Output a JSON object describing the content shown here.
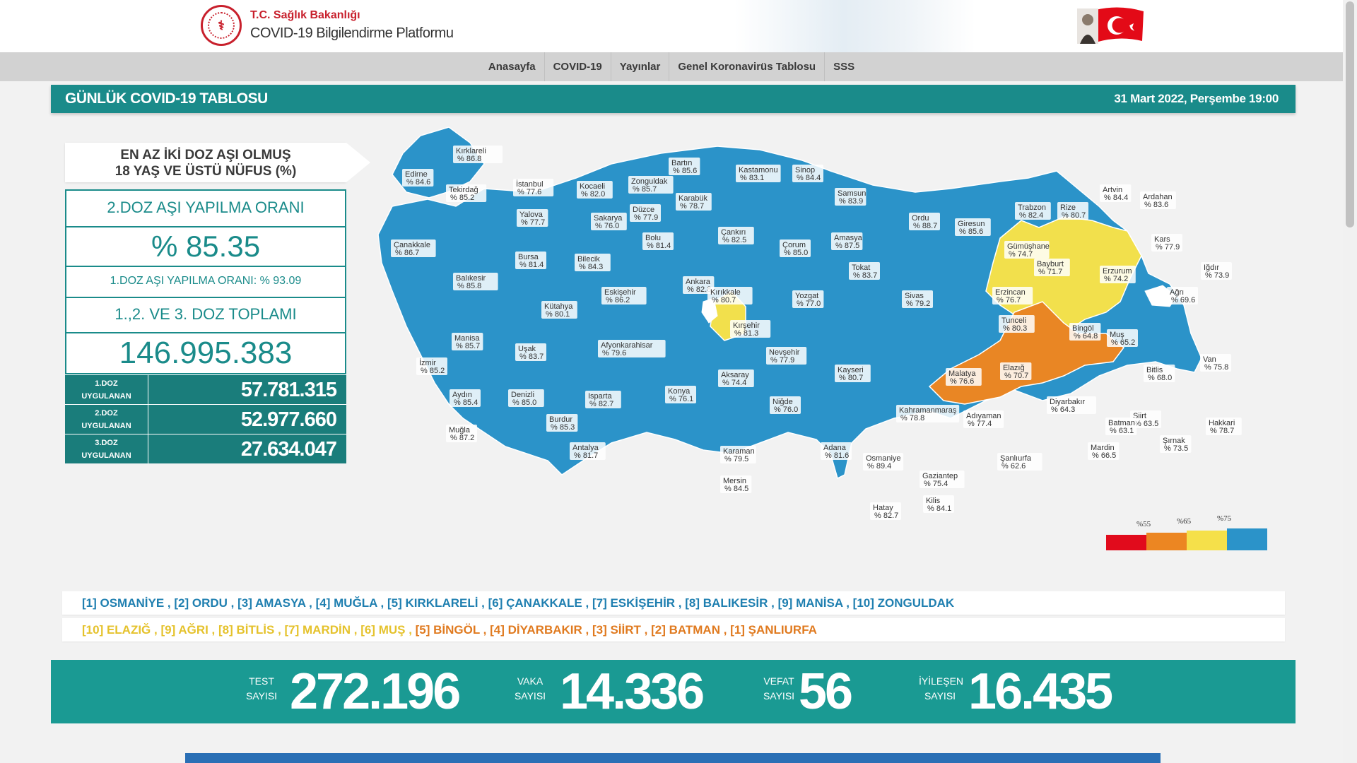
{
  "header": {
    "ministry": "T.C. Sağlık Bakanlığı",
    "platform": "COVID-19 Bilgilendirme Platformu"
  },
  "nav": [
    "Anasayfa",
    "COVID-19",
    "Yayınlar",
    "Genel Koronavirüs Tablosu",
    "SSS"
  ],
  "table_title": "GÜNLÜK COVID-19 TABLOSU",
  "date_text": "31 Mart 2022, Perşembe 19:00",
  "vaccine": {
    "title_line1": "EN AZ İKİ DOZ AŞI OLMUŞ",
    "title_line2": "18 YAŞ VE ÜSTÜ NÜFUS (%)",
    "second_dose_label": "2.DOZ AŞI YAPILMA ORANI",
    "second_dose_value": "% 85.35",
    "first_dose_rate": "1.DOZ AŞI YAPILMA ORANI: % 93.09",
    "total_label": "1.,2. VE 3. DOZ TOPLAMI",
    "total_value": "146.995.383",
    "doses": [
      {
        "label1": "1.DOZ",
        "label2": "UYGULANAN",
        "value": "57.781.315"
      },
      {
        "label1": "2.DOZ",
        "label2": "UYGULANAN",
        "value": "52.977.660"
      },
      {
        "label1": "3.DOZ",
        "label2": "UYGULANAN",
        "value": "27.634.047"
      }
    ]
  },
  "legend": {
    "ticks": [
      "%55",
      "%65",
      "%75"
    ],
    "colors": [
      "#e10b1c",
      "#ec8622",
      "#f5e04a",
      "#2b93c9"
    ]
  },
  "colors": {
    "teal": "#1a8b8a",
    "blue_province": "#2b93c9",
    "yellow_province": "#f2e04c",
    "orange_province": "#e98624",
    "yellow_text": "#e5c22c",
    "orange_text": "#e07a1f"
  },
  "top_ranking": [
    {
      "rank": "[1]",
      "name": "OSMANİYE"
    },
    {
      "rank": "[2]",
      "name": "ORDU"
    },
    {
      "rank": "[3]",
      "name": "AMASYA"
    },
    {
      "rank": "[4]",
      "name": "MUĞLA"
    },
    {
      "rank": "[5]",
      "name": "KIRKLARELİ"
    },
    {
      "rank": "[6]",
      "name": "ÇANAKKALE"
    },
    {
      "rank": "[7]",
      "name": "ESKİŞEHİR"
    },
    {
      "rank": "[8]",
      "name": "BALIKESİR"
    },
    {
      "rank": "[9]",
      "name": "MANİSA"
    },
    {
      "rank": "[10]",
      "name": "ZONGULDAK"
    }
  ],
  "bottom_ranking": [
    {
      "rank": "[10]",
      "name": "ELAZIĞ",
      "tone": "yellow"
    },
    {
      "rank": "[9]",
      "name": "AĞRI",
      "tone": "yellow"
    },
    {
      "rank": "[8]",
      "name": "BİTLİS",
      "tone": "yellow"
    },
    {
      "rank": "[7]",
      "name": "MARDİN",
      "tone": "yellow"
    },
    {
      "rank": "[6]",
      "name": "MUŞ",
      "tone": "yellow"
    },
    {
      "rank": "[5]",
      "name": "BİNGÖL",
      "tone": "orange"
    },
    {
      "rank": "[4]",
      "name": "DİYARBAKIR",
      "tone": "orange"
    },
    {
      "rank": "[3]",
      "name": "SİİRT",
      "tone": "orange"
    },
    {
      "rank": "[2]",
      "name": "BATMAN",
      "tone": "orange"
    },
    {
      "rank": "[1]",
      "name": "ŞANLIURFA",
      "tone": "orange"
    }
  ],
  "daily": {
    "test_l1": "TEST",
    "test_l2": "SAYISI",
    "test": "272.196",
    "case_l1": "VAKA",
    "case_l2": "SAYISI",
    "case": "14.336",
    "death_l1": "VEFAT",
    "death_l2": "SAYISI",
    "death": "56",
    "rec_l1": "İYİLEŞEN",
    "rec_l2": "SAYISI",
    "recovered": "16.435"
  },
  "provinces": [
    {
      "name": "Kırklareli",
      "pct": "% 86.8",
      "tone": "blue"
    },
    {
      "name": "Edirne",
      "pct": "% 84.6",
      "tone": "blue"
    },
    {
      "name": "Tekirdağ",
      "pct": "% 85.2",
      "tone": "blue"
    },
    {
      "name": "İstanbul",
      "pct": "% 77.6",
      "tone": "blue"
    },
    {
      "name": "Kocaeli",
      "pct": "% 82.0",
      "tone": "blue"
    },
    {
      "name": "Yalova",
      "pct": "% 77.7",
      "tone": "blue"
    },
    {
      "name": "Çanakkale",
      "pct": "% 86.7",
      "tone": "blue"
    },
    {
      "name": "Bursa",
      "pct": "% 81.4",
      "tone": "blue"
    },
    {
      "name": "Balıkesir",
      "pct": "% 85.8",
      "tone": "blue"
    },
    {
      "name": "Sakarya",
      "pct": "% 76.0",
      "tone": "blue"
    },
    {
      "name": "Düzce",
      "pct": "% 77.9",
      "tone": "blue"
    },
    {
      "name": "Zonguldak",
      "pct": "% 85.7",
      "tone": "blue"
    },
    {
      "name": "Bartın",
      "pct": "% 85.6",
      "tone": "blue"
    },
    {
      "name": "Karabük",
      "pct": "% 78.7",
      "tone": "blue"
    },
    {
      "name": "Bolu",
      "pct": "% 81.4",
      "tone": "blue"
    },
    {
      "name": "Bilecik",
      "pct": "% 84.3",
      "tone": "blue"
    },
    {
      "name": "Eskişehir",
      "pct": "% 86.2",
      "tone": "blue"
    },
    {
      "name": "Kütahya",
      "pct": "% 80.1",
      "tone": "blue"
    },
    {
      "name": "Manisa",
      "pct": "% 85.7",
      "tone": "blue"
    },
    {
      "name": "İzmir",
      "pct": "% 85.2",
      "tone": "blue"
    },
    {
      "name": "Uşak",
      "pct": "% 83.7",
      "tone": "blue"
    },
    {
      "name": "Afyonkarahisar",
      "pct": "% 79.6",
      "tone": "blue"
    },
    {
      "name": "Aydın",
      "pct": "% 85.4",
      "tone": "blue"
    },
    {
      "name": "Denizli",
      "pct": "% 85.0",
      "tone": "blue"
    },
    {
      "name": "Muğla",
      "pct": "% 87.2",
      "tone": "blue"
    },
    {
      "name": "Burdur",
      "pct": "% 85.3",
      "tone": "blue"
    },
    {
      "name": "Isparta",
      "pct": "% 82.7",
      "tone": "blue"
    },
    {
      "name": "Antalya",
      "pct": "% 81.7",
      "tone": "blue"
    },
    {
      "name": "Konya",
      "pct": "% 76.1",
      "tone": "blue"
    },
    {
      "name": "Karaman",
      "pct": "% 79.5",
      "tone": "blue"
    },
    {
      "name": "Mersin",
      "pct": "% 84.5",
      "tone": "blue"
    },
    {
      "name": "Ankara",
      "pct": "% 82.8",
      "tone": "blue"
    },
    {
      "name": "Kastamonu",
      "pct": "% 83.1",
      "tone": "blue"
    },
    {
      "name": "Çankırı",
      "pct": "% 82.5",
      "tone": "blue"
    },
    {
      "name": "Kırıkkale",
      "pct": "% 80.7",
      "tone": "blue"
    },
    {
      "name": "Kırşehir",
      "pct": "% 81.3",
      "tone": "blue"
    },
    {
      "name": "Aksaray",
      "pct": "% 74.4",
      "tone": "yellow"
    },
    {
      "name": "Nevşehir",
      "pct": "% 77.9",
      "tone": "blue"
    },
    {
      "name": "Niğde",
      "pct": "% 76.0",
      "tone": "blue"
    },
    {
      "name": "Sinop",
      "pct": "% 84.4",
      "tone": "blue"
    },
    {
      "name": "Samsun",
      "pct": "% 83.9",
      "tone": "blue"
    },
    {
      "name": "Çorum",
      "pct": "% 85.0",
      "tone": "blue"
    },
    {
      "name": "Amasya",
      "pct": "% 87.5",
      "tone": "blue"
    },
    {
      "name": "Tokat",
      "pct": "% 83.7",
      "tone": "blue"
    },
    {
      "name": "Yozgat",
      "pct": "% 77.0",
      "tone": "blue"
    },
    {
      "name": "Kayseri",
      "pct": "% 80.7",
      "tone": "blue"
    },
    {
      "name": "Sivas",
      "pct": "% 79.2",
      "tone": "blue"
    },
    {
      "name": "Ordu",
      "pct": "% 88.7",
      "tone": "blue"
    },
    {
      "name": "Giresun",
      "pct": "% 85.6",
      "tone": "blue"
    },
    {
      "name": "Trabzon",
      "pct": "% 82.4",
      "tone": "blue"
    },
    {
      "name": "Rize",
      "pct": "% 80.7",
      "tone": "blue"
    },
    {
      "name": "Artvin",
      "pct": "% 84.4",
      "tone": "blue"
    },
    {
      "name": "Ardahan",
      "pct": "% 83.6",
      "tone": "blue"
    },
    {
      "name": "Gümüşhane",
      "pct": "% 74.7",
      "tone": "yellow"
    },
    {
      "name": "Bayburt",
      "pct": "% 71.7",
      "tone": "yellow"
    },
    {
      "name": "Erzurum",
      "pct": "% 74.2",
      "tone": "yellow"
    },
    {
      "name": "Kars",
      "pct": "% 77.9",
      "tone": "blue"
    },
    {
      "name": "Iğdır",
      "pct": "% 73.9",
      "tone": "yellow"
    },
    {
      "name": "Ağrı",
      "pct": "% 69.6",
      "tone": "yellow"
    },
    {
      "name": "Erzincan",
      "pct": "% 76.7",
      "tone": "blue"
    },
    {
      "name": "Tunceli",
      "pct": "% 80.3",
      "tone": "blue"
    },
    {
      "name": "Bingöl",
      "pct": "% 64.8",
      "tone": "orange"
    },
    {
      "name": "Muş",
      "pct": "% 65.2",
      "tone": "yellow"
    },
    {
      "name": "Elazığ",
      "pct": "% 70.7",
      "tone": "yellow"
    },
    {
      "name": "Malatya",
      "pct": "% 76.6",
      "tone": "blue"
    },
    {
      "name": "Bitlis",
      "pct": "% 68.0",
      "tone": "yellow"
    },
    {
      "name": "Van",
      "pct": "% 75.8",
      "tone": "blue"
    },
    {
      "name": "Diyarbakır",
      "pct": "% 64.3",
      "tone": "orange"
    },
    {
      "name": "Siirt",
      "pct": "% 63.5",
      "tone": "orange"
    },
    {
      "name": "Batman",
      "pct": "% 63.1",
      "tone": "orange"
    },
    {
      "name": "Hakkari",
      "pct": "% 78.7",
      "tone": "blue"
    },
    {
      "name": "Şırnak",
      "pct": "% 73.5",
      "tone": "yellow"
    },
    {
      "name": "Mardin",
      "pct": "% 66.5",
      "tone": "yellow"
    },
    {
      "name": "Şanlıurfa",
      "pct": "% 62.6",
      "tone": "orange"
    },
    {
      "name": "Adıyaman",
      "pct": "% 77.4",
      "tone": "blue"
    },
    {
      "name": "Kahramanmaraş",
      "pct": "% 78.8",
      "tone": "blue"
    },
    {
      "name": "Gaziantep",
      "pct": "% 75.4",
      "tone": "blue"
    },
    {
      "name": "Kilis",
      "pct": "% 84.1",
      "tone": "blue"
    },
    {
      "name": "Hatay",
      "pct": "% 82.7",
      "tone": "blue"
    },
    {
      "name": "Osmaniye",
      "pct": "% 89.4",
      "tone": "blue"
    },
    {
      "name": "Adana",
      "pct": "% 81.6",
      "tone": "blue"
    }
  ]
}
